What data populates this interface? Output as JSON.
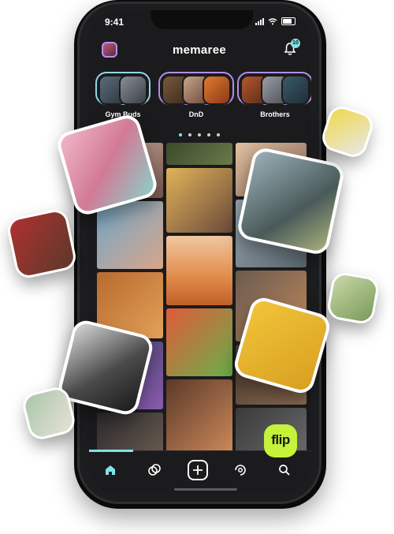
{
  "status_bar": {
    "time": "9:41"
  },
  "header": {
    "logo": "memaree",
    "notification_count": "10"
  },
  "groups": [
    {
      "label": "Gym Buds",
      "border_color": "#8fd7e6"
    },
    {
      "label": "DnD",
      "border_color": "#b38ee8"
    },
    {
      "label": "Brothers",
      "border_color": "#b38ee8"
    }
  ],
  "pagination": {
    "count": 5,
    "active_index": 0
  },
  "tabs": [
    "home",
    "circles",
    "add",
    "memories",
    "search"
  ],
  "overlay_badge": {
    "text": "flip"
  },
  "colors": {
    "accent": "#7fe3e8",
    "flip_green": "#c5f23a",
    "screen_bg": "#1b1b1d"
  }
}
